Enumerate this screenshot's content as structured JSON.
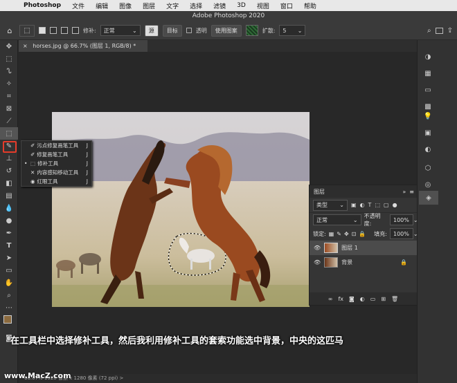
{
  "menubar": {
    "apple": "",
    "items": [
      "Photoshop",
      "文件",
      "编辑",
      "图像",
      "图层",
      "文字",
      "选择",
      "滤镜",
      "3D",
      "视图",
      "窗口",
      "帮助"
    ]
  },
  "title": "Adobe Photoshop 2020",
  "options": {
    "feather_label": "修补:",
    "mode_value": "正常",
    "source_label": "源",
    "target_label": "目标",
    "transparent_label": "透明",
    "use_pattern_label": "使用图案",
    "diffusion_label": "扩散:",
    "diffusion_value": "5"
  },
  "document_tab": "horses.jpg @ 66.7% (图层 1, RGB/8) *",
  "document_tab_close": "×",
  "flyout": {
    "items": [
      {
        "label": "污点修复画笔工具",
        "key": "J"
      },
      {
        "label": "修复画笔工具",
        "key": "J"
      },
      {
        "label": "修补工具",
        "key": "J"
      },
      {
        "label": "内容感知移动工具",
        "key": "J"
      },
      {
        "label": "红眼工具",
        "key": "J"
      }
    ],
    "selected_marker": "•"
  },
  "layers_panel": {
    "tab": "图层",
    "filter_label": "类型",
    "blend_mode": "正常",
    "opacity_label": "不透明度:",
    "opacity_value": "100%",
    "lock_label": "锁定:",
    "fill_label": "填充:",
    "fill_value": "100%",
    "layers": [
      {
        "name": "图层 1",
        "selected": true
      },
      {
        "name": "背景",
        "selected": false
      }
    ]
  },
  "caption": "在工具栏中选择修补工具，然后我利用修补工具的套索功能选中背景，中央的这匹马",
  "status": "66.67%     1920 像素 x 1280 像素 (72 ppi)    >",
  "watermark": "www.MacZ.com",
  "colors": {
    "highlight": "#e53b2a",
    "foreground": "#8b6a3e",
    "background": "#000000"
  }
}
